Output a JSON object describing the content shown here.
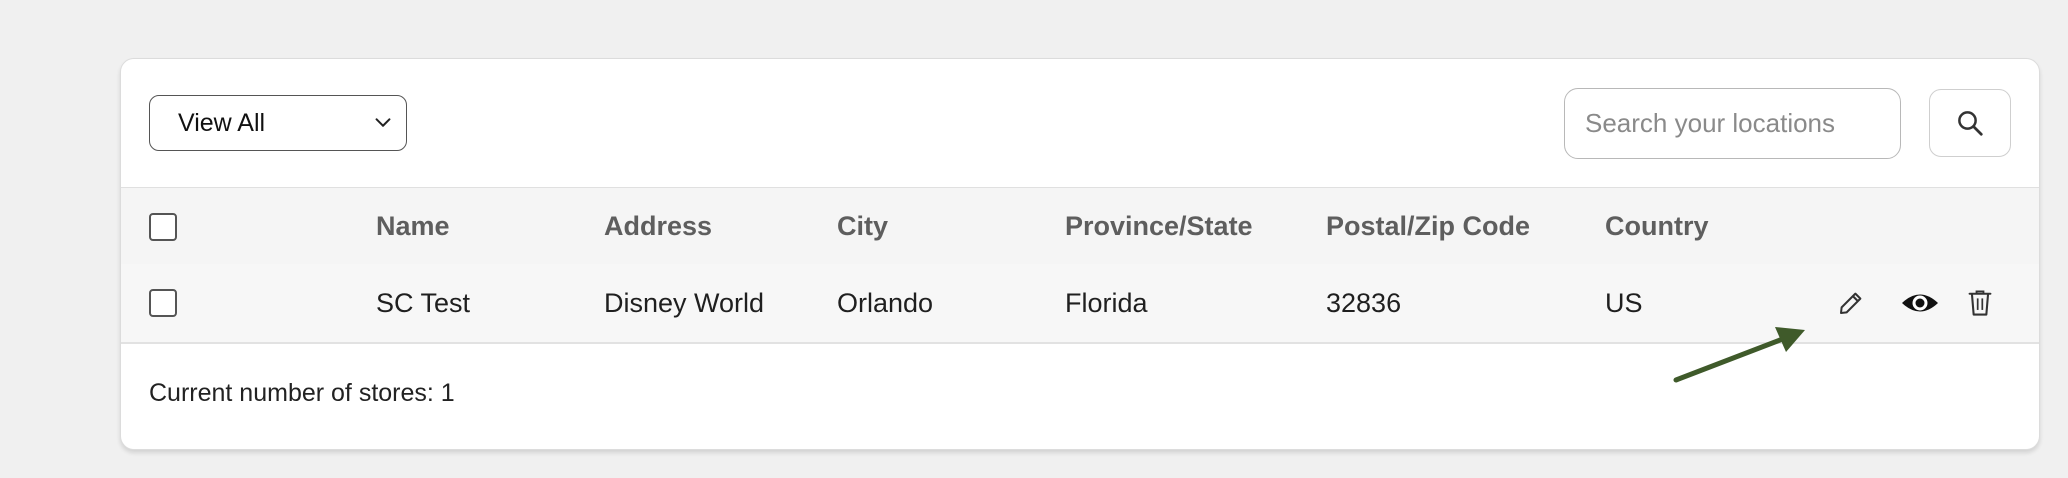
{
  "filter": {
    "selected": "View All"
  },
  "search": {
    "placeholder": "Search your locations"
  },
  "table": {
    "headers": [
      "Name",
      "Address",
      "City",
      "Province/State",
      "Postal/Zip Code",
      "Country"
    ],
    "rows": [
      [
        "SC Test",
        "Disney World",
        "Orlando",
        "Florida",
        "32836",
        "US"
      ]
    ]
  },
  "footer": {
    "count_text": "Current number of stores: 1"
  },
  "icons": {
    "edit": "pencil-icon",
    "view": "eye-icon",
    "delete": "trash-icon",
    "search": "search-icon",
    "dropdown": "chevron-down-icon"
  },
  "colors": {
    "annotation_arrow": "#3f5a2a"
  }
}
